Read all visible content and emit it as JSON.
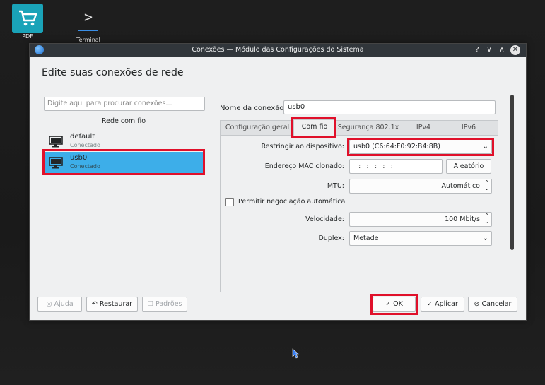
{
  "desktop": {
    "pdf_label": "PDF",
    "terminal_label": "Terminal"
  },
  "window": {
    "title": "Conexões — Módulo das Configurações do Sistema",
    "heading": "Edite suas conexões de rede"
  },
  "left": {
    "search_placeholder": "Digite aqui para procurar conexões...",
    "group_label": "Rede com fio",
    "connections": [
      {
        "name": "default",
        "state": "Conectado"
      },
      {
        "name": "usb0",
        "state": "Conectado"
      }
    ]
  },
  "right": {
    "conn_name_label": "Nome da conexão:",
    "conn_name_value": "usb0",
    "tabs": [
      "Configuração geral",
      "Com fio",
      "Segurança 802.1x",
      "IPv4",
      "IPv6"
    ],
    "active_tab": "Com fio",
    "restrict_label": "Restringir ao dispositivo:",
    "restrict_value": "usb0 (C6:64:F0:92:B4:8B)",
    "mac_label": "Endereço MAC clonado:",
    "mac_value": "_:_:_:_:_:_",
    "random_button": "Aleatório",
    "mtu_label": "MTU:",
    "mtu_value": "Automático",
    "autoneg_label": "Permitir negociação automática",
    "speed_label": "Velocidade:",
    "speed_value": "100 Mbit/s",
    "duplex_label": "Duplex:",
    "duplex_value": "Metade"
  },
  "footer": {
    "help": "Ajuda",
    "restore": "Restaurar",
    "defaults": "Padrões",
    "ok": "OK",
    "apply": "Aplicar",
    "cancel": "Cancelar"
  },
  "colors": {
    "selection": "#3daee9",
    "highlight": "#e0102a",
    "titlebar": "#31363b"
  }
}
